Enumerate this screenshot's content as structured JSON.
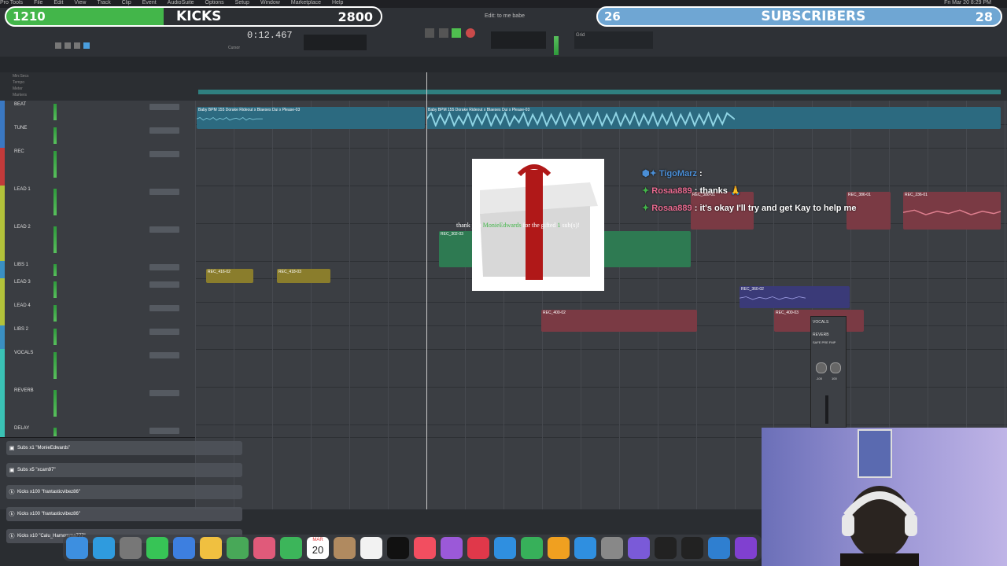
{
  "menubar": {
    "items": [
      "Pro Tools",
      "File",
      "Edit",
      "View",
      "Track",
      "Clip",
      "Event",
      "AudioSuite",
      "Options",
      "Setup",
      "Window",
      "Marketplace",
      "Help"
    ],
    "clock": "Fri Mar 20  8:29 PM"
  },
  "overlay": {
    "kicks_left": "1210",
    "kicks_label": "KICKS",
    "kicks_right": "2800",
    "subs_left": "26",
    "subs_label": "SUBSCRIBERS",
    "subs_right": "28"
  },
  "daw": {
    "window_title": "Edit: to me babe",
    "counter": "0:12.467",
    "cursor_label": "Cursor",
    "grid_label": "Grid",
    "nudge_label": "Nudge"
  },
  "rulers": [
    "Min:Secs",
    "Tempo",
    "Meter",
    "Markers"
  ],
  "tracks": [
    {
      "name": "BEAT",
      "color": "#3a78c2"
    },
    {
      "name": "TUNE",
      "color": "#3a78c2"
    },
    {
      "name": "REC",
      "color": "#c23a3a"
    },
    {
      "name": "LEAD 1",
      "color": "#b2c23a"
    },
    {
      "name": "LEAD 2",
      "color": "#b2c23a"
    },
    {
      "name": "LIBS 1",
      "color": "#3a8fc2"
    },
    {
      "name": "LEAD 3",
      "color": "#b2c23a"
    },
    {
      "name": "LEAD 4",
      "color": "#b2c23a"
    },
    {
      "name": "LIBS 2",
      "color": "#3a8fc2"
    },
    {
      "name": "VOCALS",
      "color": "#3ac2b5"
    },
    {
      "name": "REVERB",
      "color": "#3ac2b5"
    },
    {
      "name": "DELAY",
      "color": "#3ac2b5"
    }
  ],
  "clips": {
    "beat_1": "Baby BPM 155 Dorake Rideout x Blaeses Dui x Please-03",
    "beat_2": "Baby BPM 155 Dorake Rideout x Blaeses Dui x Please-03",
    "rec_302": "REC_302-03",
    "rec_386": "REC_386-01",
    "rec_236": "REC_236-01",
    "rec_416": "REC_416-02",
    "rec_418": "REC_418-03",
    "rec_400": "REC_400-02",
    "rec_360": "REC_360-02",
    "rec_361": "REC_360-0",
    "rec_401": "REC_400-03"
  },
  "gift": {
    "caption_pre": "thank you",
    "caption_user": "MonieEdwards",
    "caption_mid": "for the gifted",
    "caption_count": "1",
    "caption_post": "sub(s)!"
  },
  "chat": [
    {
      "user": "TigoMarz",
      "message": ""
    },
    {
      "user": "Rosaa889",
      "message": ": thanks 🙏"
    },
    {
      "user": "Rosaa889",
      "message": ": it's okay I'll try and get Kay to help me"
    }
  ],
  "alerts": [
    {
      "icon": "gift-icon",
      "text": "Subs x1 \"MonieEdwards\""
    },
    {
      "icon": "gift-icon",
      "text": "Subs x5 \"xcam97\""
    },
    {
      "icon": "kick-icon",
      "text": "Kicks x100 \"frantasticvibez86\""
    },
    {
      "icon": "kick-icon",
      "text": "Kicks x100 \"frantasticvibez86\""
    },
    {
      "icon": "kick-icon",
      "text": "Kicks x10 \"Calu_Hamomma777\""
    }
  ],
  "dock": {
    "calendar_month": "MAR",
    "calendar_day": "20",
    "apps": [
      "finder-icon",
      "safari-icon",
      "launchpad-icon",
      "messages-icon",
      "mail-icon",
      "notes-icon",
      "maps-icon",
      "photos-icon",
      "facetime-icon",
      "calendar-icon",
      "contacts-icon",
      "reminders-icon",
      "appletv-icon",
      "music-icon",
      "podcasts-icon",
      "news-icon",
      "keynote-icon",
      "numbers-icon",
      "pages-icon",
      "appstore-icon",
      "settings-icon",
      "protools-icon",
      "ilok-icon",
      "capcut-icon",
      "audio-icon",
      "avid-icon"
    ]
  },
  "mixer": {
    "label": "VOCALS",
    "insert": "REVERB",
    "mode": "SAFE  PRE  FMP",
    "vol": "-100",
    "pan": "100"
  }
}
